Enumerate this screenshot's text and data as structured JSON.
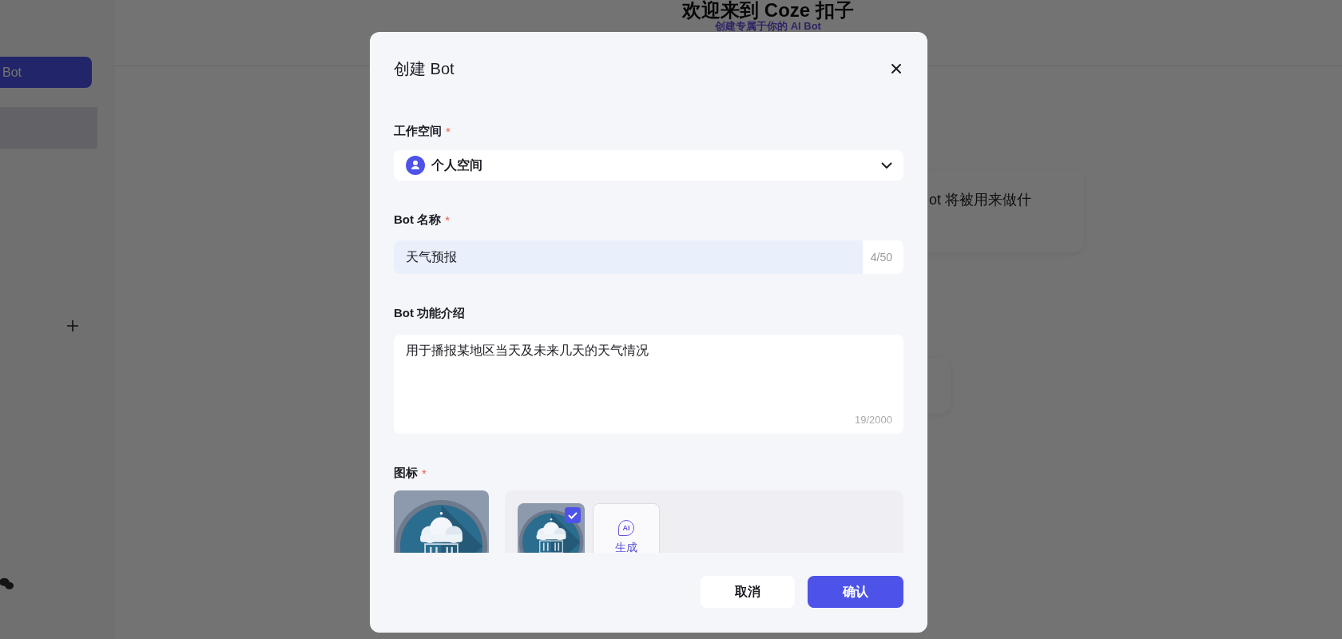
{
  "page": {
    "heading": "欢迎来到 Coze 扣子",
    "subheading": "创建专属于你的 AI Bot",
    "sidebar_item": {
      "label": "Bot",
      "selected": true
    },
    "card_text": "ot 将被用来做什"
  },
  "dialog": {
    "title": "创建 Bot",
    "fields": [
      {
        "kind": "select",
        "label": "工作空间",
        "marker": "*",
        "value": "个人空间"
      },
      {
        "kind": "input",
        "label": "Bot 名称",
        "marker": "*",
        "value": "天气预报",
        "counter": "4/50"
      },
      {
        "kind": "textarea",
        "label": "Bot 功能介绍",
        "value": "用于播报某地区当天及未来几天的天气情况",
        "counter": "19/2000"
      },
      {
        "kind": "icons",
        "label": "图标",
        "marker": "*",
        "options": [
          {
            "kind": "picture",
            "selected": true
          },
          {
            "kind": "generate",
            "badge": "AI",
            "label": "生成",
            "selected": false
          }
        ]
      }
    ],
    "buttons": [
      {
        "kind": "secondary",
        "label": "取消"
      },
      {
        "kind": "primary",
        "label": "确认"
      }
    ]
  }
}
